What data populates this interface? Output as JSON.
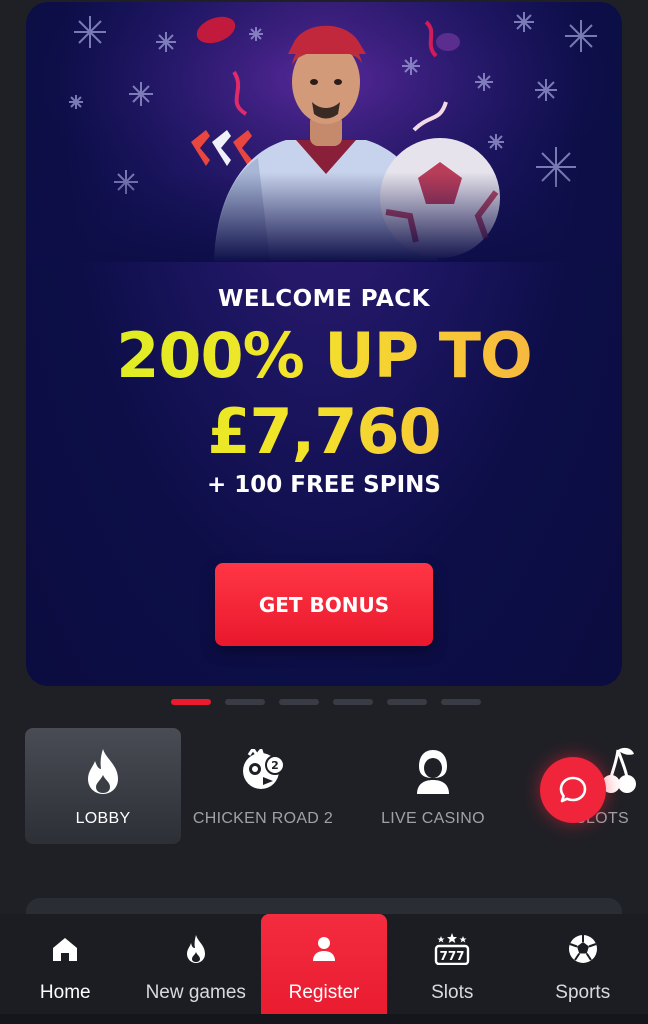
{
  "banner": {
    "eyebrow": "WELCOME PACK",
    "headline_line1": "200% UP TO",
    "headline_line2": "£7,760",
    "subline": "+ 100 FREE SPINS",
    "cta_label": "GET BONUS",
    "slides_total": 6,
    "slide_active": 1
  },
  "categories": [
    {
      "label": "LOBBY",
      "icon": "flame-icon",
      "active": true
    },
    {
      "label": "CHICKEN ROAD 2",
      "icon": "chicken-icon",
      "active": false
    },
    {
      "label": "LIVE CASINO",
      "icon": "dealer-icon",
      "active": false
    },
    {
      "label": "SLOTS",
      "icon": "cherry-icon",
      "active": false
    }
  ],
  "nav": {
    "home": "Home",
    "new_games": "New games",
    "register": "Register",
    "slots": "Slots",
    "sports": "Sports"
  },
  "colors": {
    "accent": "#ea1b2e",
    "background": "#1f2026",
    "banner_bg": "#0d0e48",
    "headline_gradient_start": "#d6f21e",
    "headline_gradient_end": "#f4a845"
  }
}
